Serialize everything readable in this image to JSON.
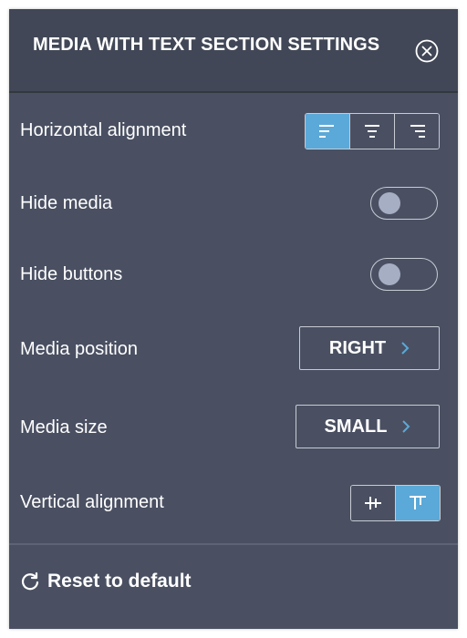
{
  "header": {
    "title": "MEDIA WITH TEXT SECTION SETTINGS",
    "close_icon": "close-circle-icon"
  },
  "settings": {
    "horizontal_alignment": {
      "label": "Horizontal alignment",
      "options": [
        "align-left-icon",
        "align-center-icon",
        "align-right-icon"
      ],
      "selected": "align-left-icon"
    },
    "hide_media": {
      "label": "Hide media",
      "on": false
    },
    "hide_buttons": {
      "label": "Hide buttons",
      "on": false
    },
    "media_position": {
      "label": "Media position",
      "value": "RIGHT"
    },
    "media_size": {
      "label": "Media size",
      "value": "SMALL"
    },
    "vertical_alignment": {
      "label": "Vertical alignment",
      "options": [
        "align-middle-icon",
        "align-top-icon"
      ],
      "selected": "align-top-icon"
    }
  },
  "footer": {
    "reset_label": "Reset to default",
    "reset_icon": "refresh-icon"
  },
  "colors": {
    "panel_bg": "#4a5062",
    "header_bg": "#414756",
    "accent": "#5ba9d8",
    "border": "#c7cbd4",
    "knob": "#a6aec4"
  }
}
